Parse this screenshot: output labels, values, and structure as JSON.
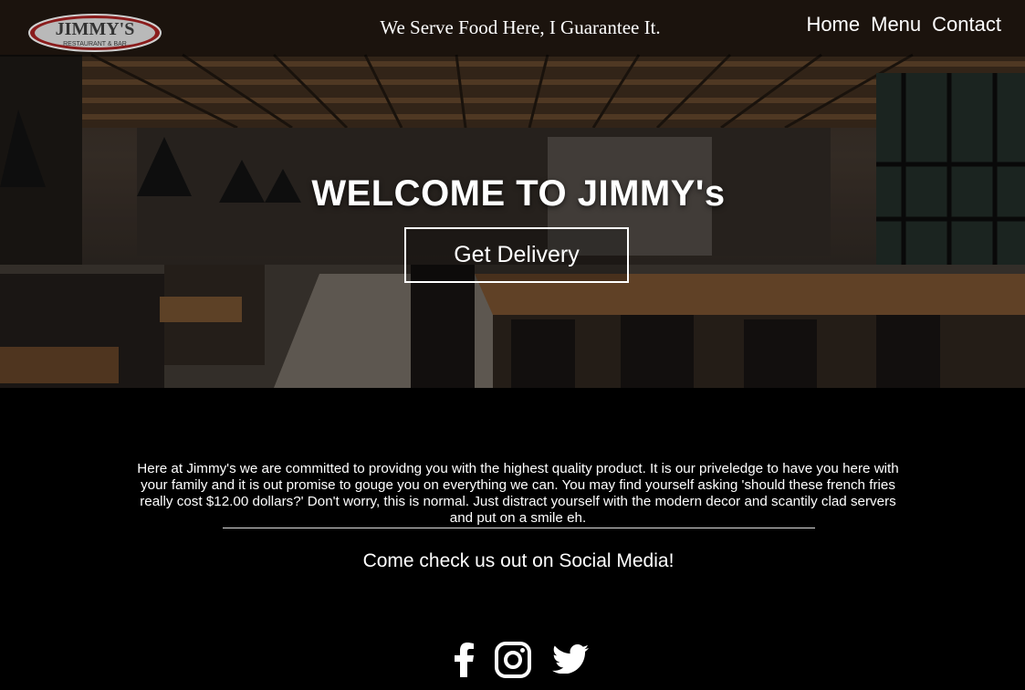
{
  "brand": {
    "logo_text": "JIMMY'S",
    "logo_subtext": "RESTAURANT & BAR"
  },
  "header": {
    "tagline": "We Serve Food Here, I Guarantee It.",
    "nav": [
      {
        "label": "Home"
      },
      {
        "label": "Menu"
      },
      {
        "label": "Contact"
      }
    ]
  },
  "hero": {
    "title": "WELCOME TO JIMMY's",
    "cta_label": "Get Delivery"
  },
  "about": {
    "text": "Here at Jimmy's we are committed to providng you with the highest quality product. It is our priveledge to have you here with your family and it is out promise to gouge you on everything we can. You may find yourself asking 'should these french fries really cost $12.00 dollars?' Don't worry, this is normal. Just distract yourself with the modern decor and scantily clad servers and put on a smile eh."
  },
  "social": {
    "heading": "Come check us out on Social Media!",
    "icons": [
      "facebook-icon",
      "instagram-icon",
      "twitter-icon"
    ]
  },
  "colors": {
    "background": "#000000",
    "text": "#ffffff",
    "logo_red": "#8a1c1c"
  }
}
